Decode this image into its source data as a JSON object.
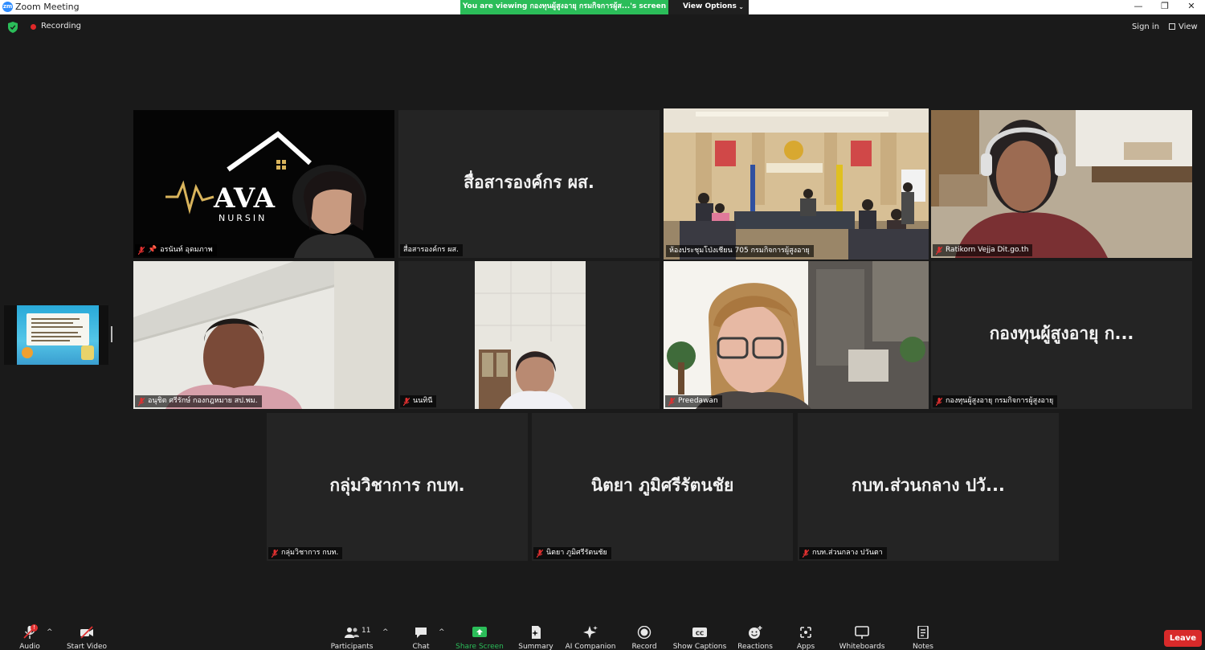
{
  "window": {
    "app_icon_text": "zm",
    "title": "Zoom Meeting",
    "minimize": "—",
    "restore": "❐",
    "close": "✕"
  },
  "share_banner": {
    "text": "You are viewing กองทุนผู้สูงอายุ กรมกิจการผู้ส...'s screen",
    "button": "View Options"
  },
  "top": {
    "recording": "Recording",
    "sign_in": "Sign in",
    "view": "View"
  },
  "tiles": [
    {
      "id": "t1",
      "name": "อรนันท์ อุดมภาพ",
      "muted": true,
      "pinned": true,
      "logo_text": "AVA",
      "logo_sub": "NURSIN"
    },
    {
      "id": "t2",
      "name": "สื่อสารองค์กร ผส.",
      "display": "สื่อสารองค์กร ผส.",
      "muted": false
    },
    {
      "id": "t3",
      "name": "ห้องประชุมโป่งเชียน 705 กรมกิจการผู้สูงอายุ",
      "muted": false,
      "active": true
    },
    {
      "id": "t4",
      "name": "Ratikorn Vejja  Dit.go.th",
      "muted": true
    },
    {
      "id": "t5",
      "name": "อนุชิต ศรีรักษ์ กองกฎหมาย สป.พม.",
      "muted": true
    },
    {
      "id": "t6",
      "name": "นนทินี",
      "muted": true
    },
    {
      "id": "t7",
      "name": "Preedawan",
      "muted": true
    },
    {
      "id": "t8",
      "name": "กองทุนผู้สูงอายุ กรมกิจการผู้สูงอายุ",
      "display": "กองทุนผู้สูงอายุ ก...",
      "muted": true
    },
    {
      "id": "t9",
      "name": "กลุ่มวิชาการ กบท.",
      "display": "กลุ่มวิชาการ กบท.",
      "muted": true
    },
    {
      "id": "t10",
      "name": "นิตยา ภูมิศรีรัตนชัย",
      "display": "นิตยา ภูมิศรีรัตนชัย",
      "muted": true
    },
    {
      "id": "t11",
      "name": "กบท.ส่วนกลาง ปวันตา",
      "display": "กบท.ส่วนกลาง ปวั...",
      "muted": true
    }
  ],
  "toolbar": {
    "audio": "Audio",
    "start_video": "Start Video",
    "participants": "Participants",
    "participants_count": "11",
    "chat": "Chat",
    "share_screen": "Share Screen",
    "summary": "Summary",
    "ai_companion": "AI Companion",
    "record": "Record",
    "show_captions": "Show Captions",
    "reactions": "Reactions",
    "apps": "Apps",
    "whiteboards": "Whiteboards",
    "notes": "Notes",
    "leave": "Leave",
    "audio_badge": "!"
  },
  "colors": {
    "background": "#1a1a1a",
    "tile": "#242424",
    "active_border": "#e8e85a",
    "banner": "#2bbd59",
    "share_green": "#2bbd59",
    "leave_red": "#d82a2a",
    "muted_red": "#e03030"
  }
}
